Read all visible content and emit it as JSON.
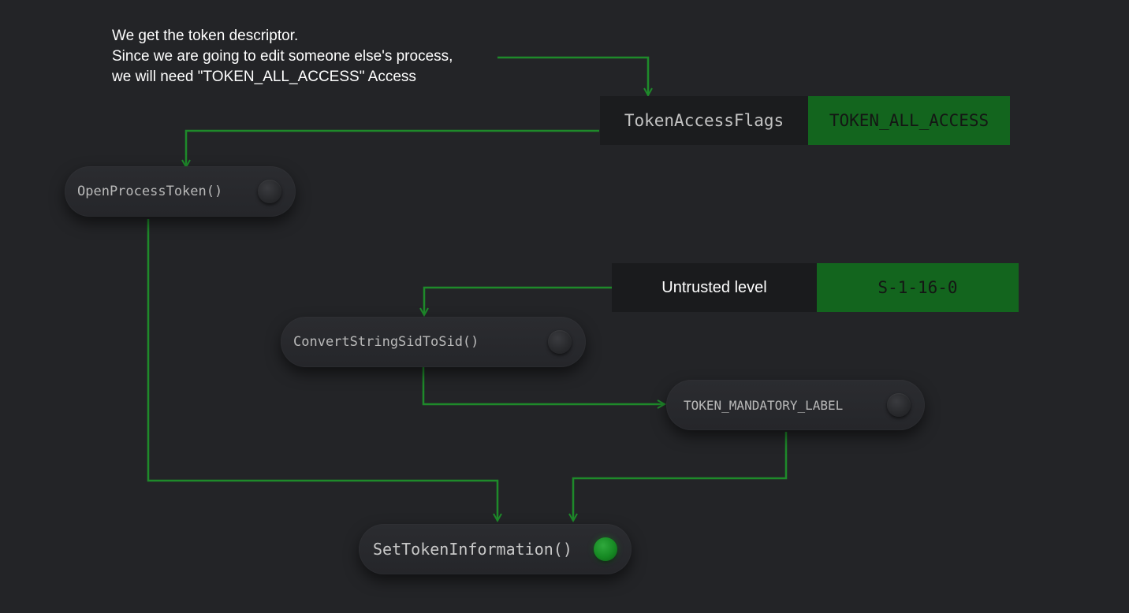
{
  "note": {
    "line1": "We get the token descriptor.",
    "line2": "Since we are going to edit someone else's process,",
    "line3": "we will need \"TOKEN_ALL_ACCESS\" Access"
  },
  "params": {
    "access_flags": {
      "key": "TokenAccessFlags",
      "value": "TOKEN_ALL_ACCESS"
    },
    "integrity": {
      "key": "Untrusted level",
      "value": "S-1-16-0"
    }
  },
  "nodes": {
    "open_process_token": {
      "label": "OpenProcessToken()",
      "status": "inactive"
    },
    "convert_sid": {
      "label": "ConvertStringSidToSid()",
      "status": "inactive"
    },
    "mandatory_label": {
      "label": "TOKEN_MANDATORY_LABEL",
      "status": "inactive"
    },
    "set_token_info": {
      "label": "SetTokenInformation()",
      "status": "active"
    }
  },
  "colors": {
    "background": "#232427",
    "wire": "#1e8a2a",
    "value_fill": "#13651e",
    "active_led": "#168a23"
  }
}
